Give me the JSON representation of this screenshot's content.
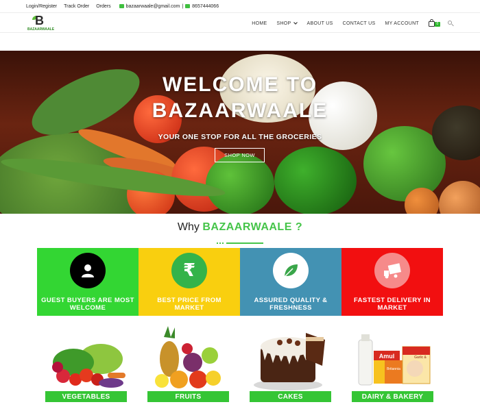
{
  "topbar": {
    "login": "Login/Register",
    "track": "Track Order",
    "orders": "Orders",
    "email": "bazaarwaale@gmail.com",
    "separator": "|",
    "phone": "8657444066"
  },
  "logo": {
    "mark": "B",
    "word": "BAZAARWAALE"
  },
  "nav": {
    "home": "HOME",
    "shop": "SHOP",
    "about": "ABOUT US",
    "contact": "CONTACT US",
    "account": "MY ACCOUNT",
    "cart_count": "0"
  },
  "hero": {
    "line1": "WELCOME TO",
    "line2": "BAZAARWAALE",
    "subtitle": "YOUR ONE STOP FOR ALL THE GROCERIES",
    "button": "SHOP NOW"
  },
  "why": {
    "prefix": "Why",
    "brand": "BAZAARWAALE ?"
  },
  "features": [
    {
      "label": "GUEST BUYERS ARE MOST WELCOME",
      "bg": "#33d633",
      "icon": "user-icon"
    },
    {
      "label": "BEST PRICE FROM MARKET",
      "bg": "#f9cf0f",
      "icon": "rupee-icon"
    },
    {
      "label": "ASSURED QUALITY & FRESHNESS",
      "bg": "#4392b3",
      "icon": "leaf-icon"
    },
    {
      "label": "FASTEST DELIVERY IN MARKET",
      "bg": "#f20f10",
      "icon": "truck-icon"
    }
  ],
  "categories": [
    {
      "label": "VEGETABLES"
    },
    {
      "label": "FRUITS"
    },
    {
      "label": "CAKES"
    },
    {
      "label": "DAIRY & BAKERY"
    }
  ],
  "product_text": {
    "amul": "Amul",
    "britannia": "Britannia",
    "ghee": "Garlic &"
  },
  "colors": {
    "accent_green": "#45c449",
    "category_green": "#35c535"
  }
}
